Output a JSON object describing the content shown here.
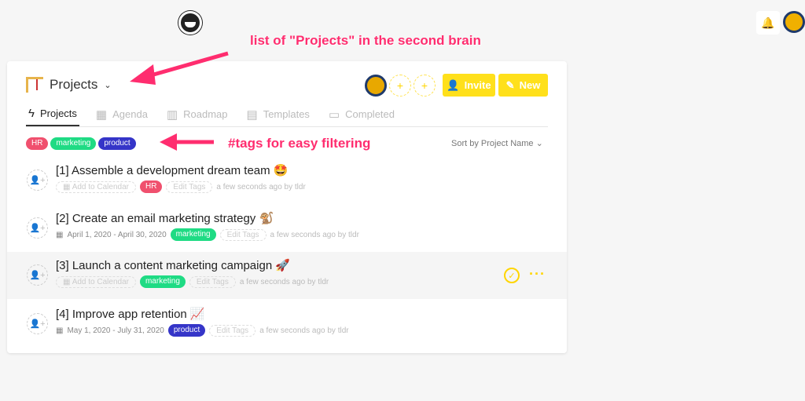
{
  "annotations": {
    "projects": "list of \"Projects\" in the second brain",
    "tags": "#tags for easy filtering"
  },
  "header": {
    "title": "Projects",
    "invite": "Invite",
    "new": "New",
    "add_member": "+"
  },
  "tabs": [
    {
      "label": "Projects",
      "icon": "lightning-icon"
    },
    {
      "label": "Agenda",
      "icon": "calendar-icon"
    },
    {
      "label": "Roadmap",
      "icon": "map-icon"
    },
    {
      "label": "Templates",
      "icon": "document-icon"
    },
    {
      "label": "Completed",
      "icon": "archive-icon"
    }
  ],
  "filters": [
    {
      "label": "HR",
      "color": "#f0506e"
    },
    {
      "label": "marketing",
      "color": "#1fdb84"
    },
    {
      "label": "product",
      "color": "#3535c8"
    }
  ],
  "sort": "Sort by Project Name",
  "projects": [
    {
      "title": "[1] Assemble a development dream team 🤩",
      "date": "Add to Calendar",
      "tag": "HR",
      "edit": "Edit Tags",
      "updated": "a few seconds ago by tldr"
    },
    {
      "title": "[2] Create an email marketing strategy 🐒",
      "date": "April 1, 2020 - April 30, 2020",
      "tag": "marketing",
      "edit": "Edit Tags",
      "updated": "a few seconds ago by tldr"
    },
    {
      "title": "[3] Launch a content marketing campaign 🚀",
      "date": "Add to Calendar",
      "tag": "marketing",
      "edit": "Edit Tags",
      "updated": "a few seconds ago by tldr"
    },
    {
      "title": "[4] Improve app retention 📈",
      "date": "May 1, 2020 - July 31, 2020",
      "tag": "product",
      "edit": "Edit Tags",
      "updated": "a few seconds ago by tldr"
    }
  ]
}
